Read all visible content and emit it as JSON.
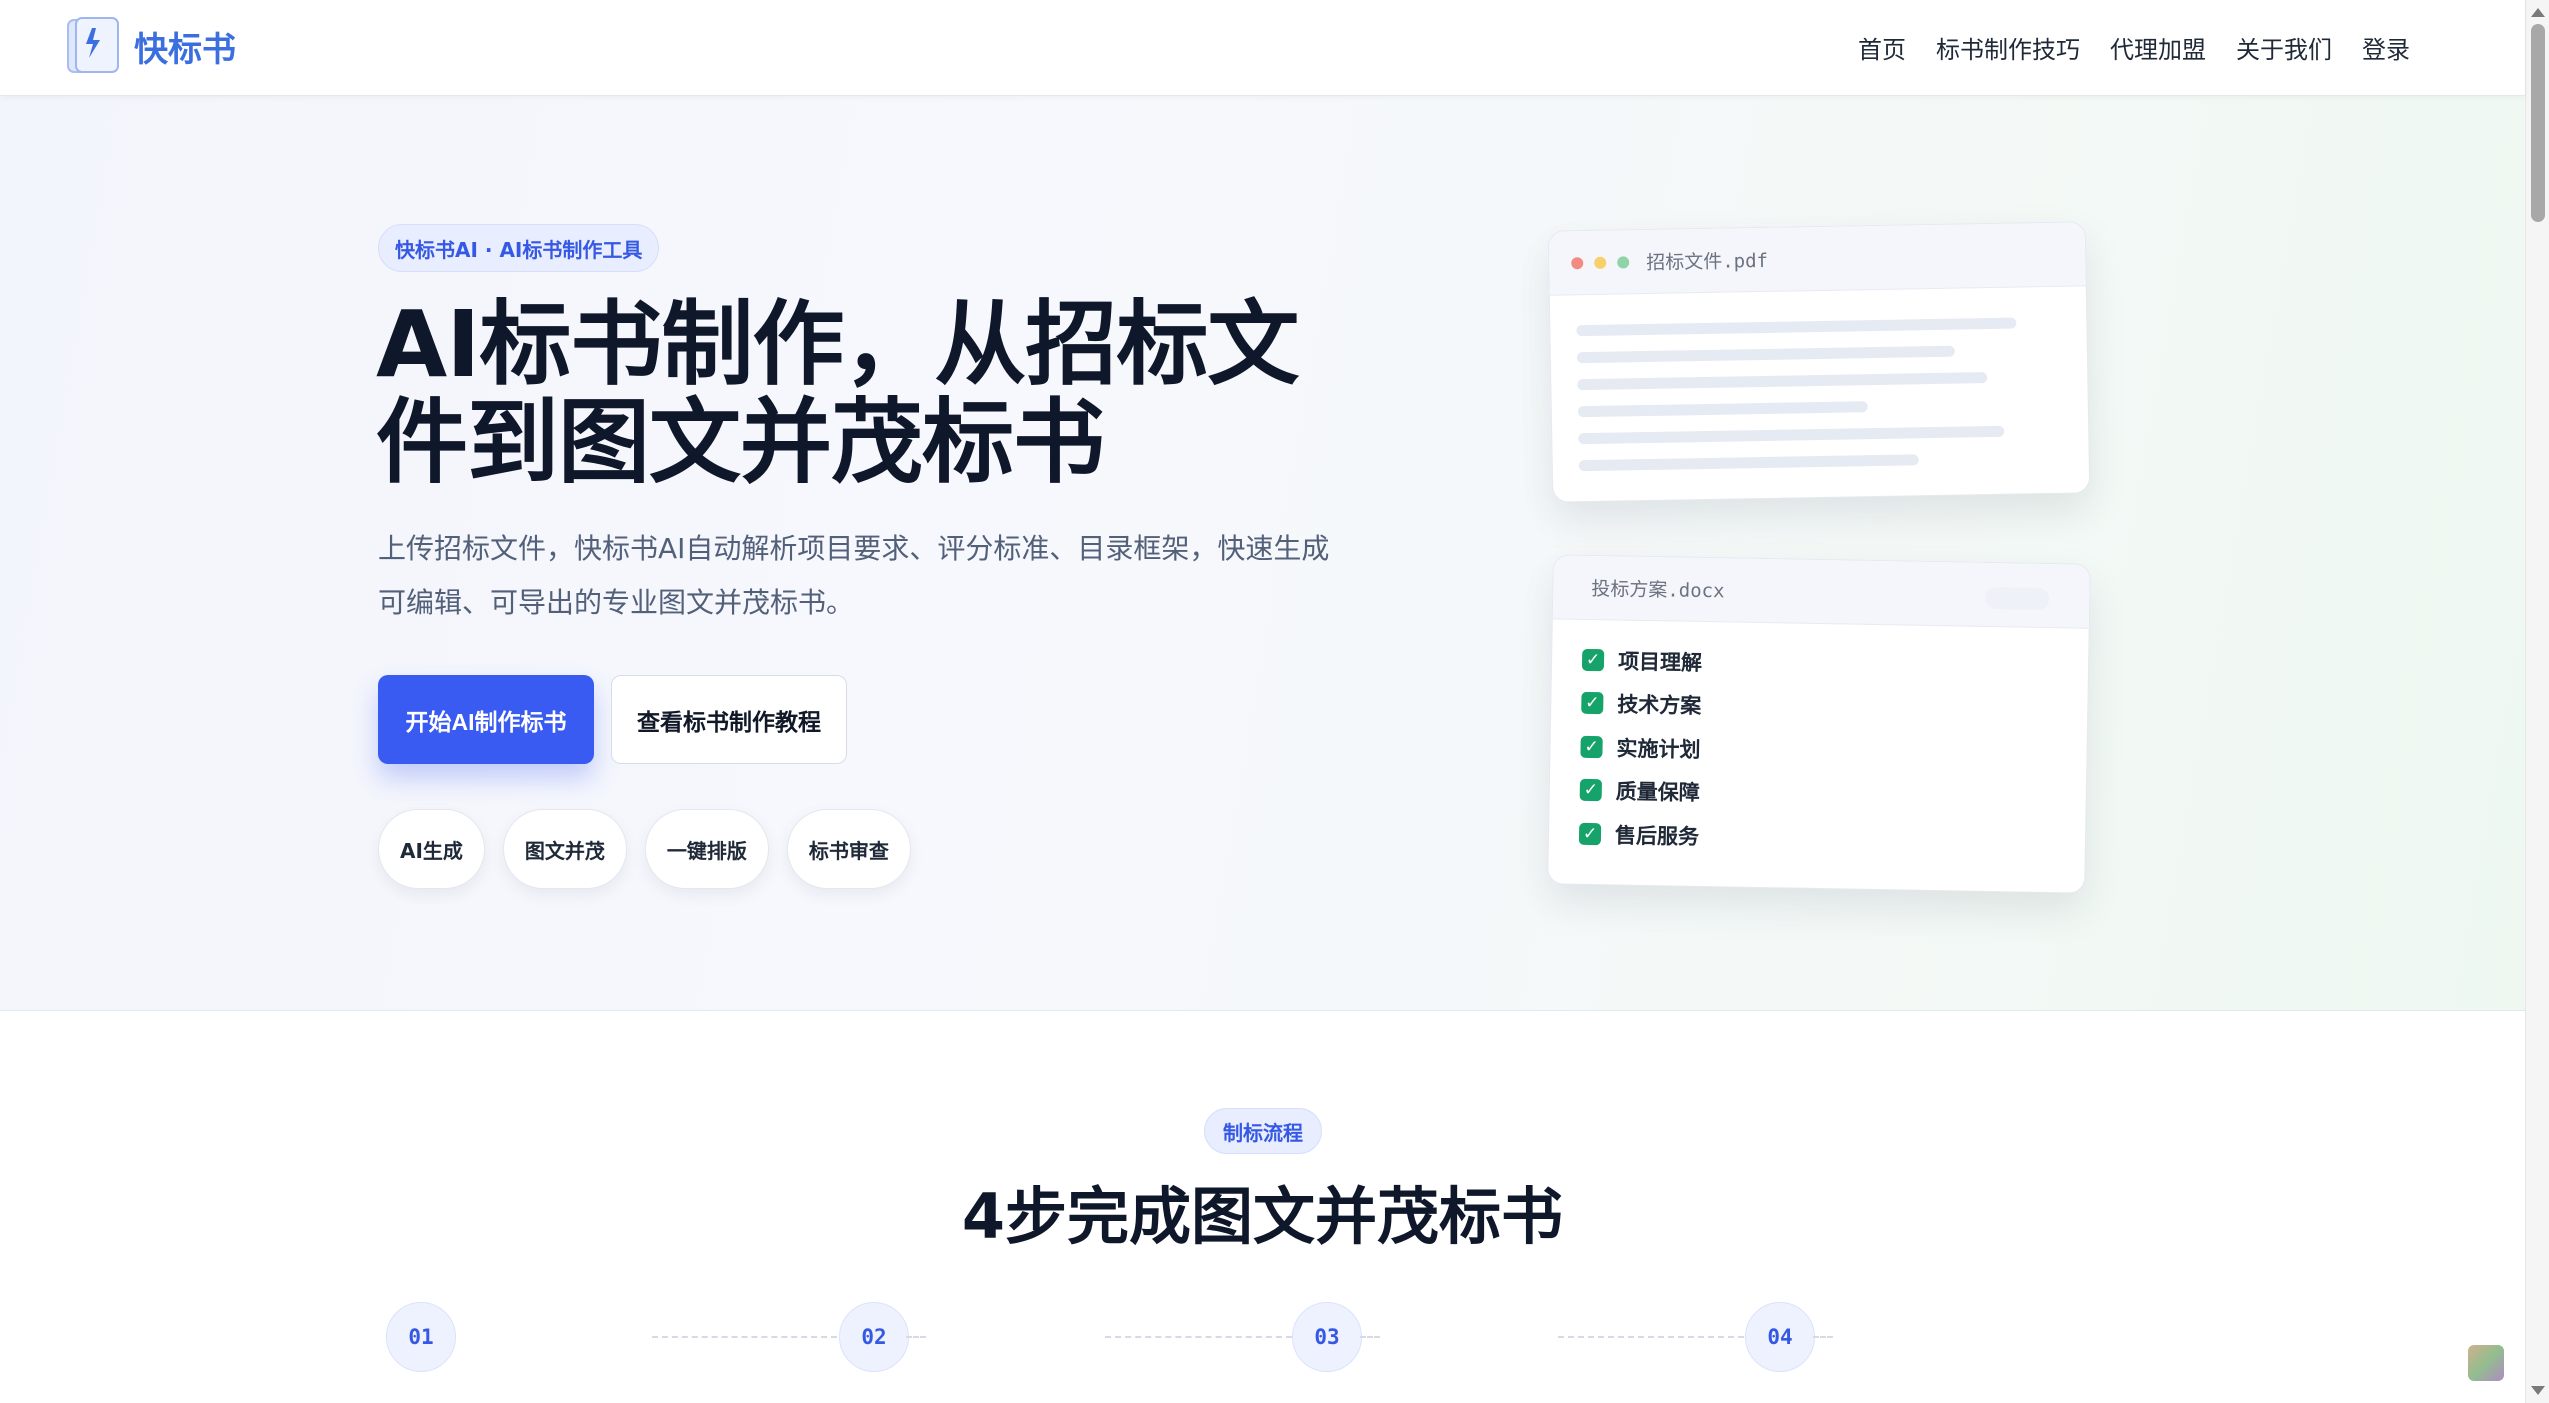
{
  "brand": {
    "name": "快标书"
  },
  "nav": {
    "items": [
      "首页",
      "标书制作技巧",
      "代理加盟",
      "关于我们",
      "登录"
    ]
  },
  "hero": {
    "badge": "快标书AI · AI标书制作工具",
    "title_line1": "AI标书制作，从招标文",
    "title_line2": "件到图文并茂标书",
    "desc_line1": "上传招标文件，快标书AI自动解析项目要求、评分标准、目录框架，快速生成",
    "desc_line2": "可编辑、可导出的专业图文并茂标书。",
    "primary_button": "开始AI制作标书",
    "secondary_button": "查看标书制作教程",
    "chips": [
      "AI生成",
      "图文并茂",
      "一键排版",
      "标书审查"
    ]
  },
  "preview": {
    "input_file": "招标文件.pdf",
    "output_file": "投标方案.docx",
    "checklist": [
      "项目理解",
      "技术方案",
      "实施计划",
      "质量保障",
      "售后服务"
    ],
    "check_mark": "✓",
    "colors": {
      "dot_red": "#f28b82",
      "dot_yellow": "#f7cf6b",
      "dot_green": "#8fd4a6",
      "check": "#16a36a"
    }
  },
  "process": {
    "badge": "制标流程",
    "title": "4步完成图文并茂标书",
    "steps": [
      "01",
      "02",
      "03",
      "04"
    ]
  },
  "colors": {
    "accent": "#3a5bf2",
    "brand": "#3b6fe0"
  }
}
